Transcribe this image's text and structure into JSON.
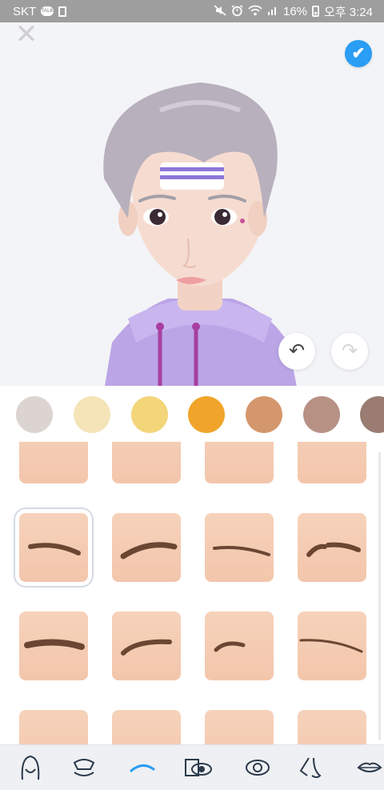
{
  "status_bar": {
    "carrier": "SKT",
    "talk_icon_text": "TALK",
    "battery": "16%",
    "time": "오후 3:24",
    "icons": [
      "kakaotalk-icon",
      "sim-icon",
      "mute-icon",
      "alarm-icon",
      "wifi-icon",
      "signal-icon",
      "battery-icon"
    ]
  },
  "header": {
    "close_glyph": "✕",
    "confirm_glyph": "✔",
    "undo_glyph": "↶",
    "redo_glyph": "↷"
  },
  "colors": {
    "accent": "#2a9df4",
    "swatches": [
      "#dcd4d0",
      "#f5e4b8",
      "#f3d57a",
      "#f0a52a",
      "#d4976c",
      "#b89185",
      "#9a7c73"
    ]
  },
  "eyebrows": {
    "selected_index": 4,
    "styles": [
      "partial-straight",
      "partial-arched",
      "partial-flat",
      "partial-flat-thin",
      "soft-arch",
      "high-arch",
      "straight-thin",
      "broken-arch",
      "thick-straight",
      "sharp-arch",
      "short-tail",
      "long-thin",
      "partial-a",
      "partial-b",
      "partial-c",
      "partial-d"
    ]
  },
  "toolbar": {
    "items": [
      "face-shape",
      "hair",
      "eyebrows",
      "eye-makeup",
      "eyes",
      "nose",
      "lips"
    ],
    "active_index": 2
  }
}
